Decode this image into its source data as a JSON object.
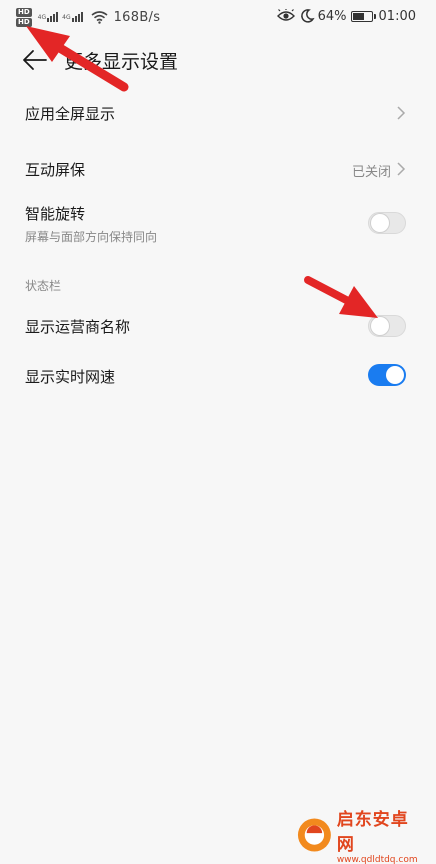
{
  "status_bar": {
    "hd_labels": [
      "HD",
      "HD"
    ],
    "sim1_tag": "4G",
    "sim2_tag": "4G",
    "net_speed": "168B/s",
    "battery_percent": "64%",
    "battery_level": 0.64,
    "time": "01:00"
  },
  "header": {
    "title": "更多显示设置"
  },
  "settings": {
    "fullscreen_apps": {
      "label": "应用全屏显示"
    },
    "interactive_screensaver": {
      "label": "互动屏保",
      "value": "已关闭"
    },
    "smart_rotate": {
      "label": "智能旋转",
      "sublabel": "屏幕与面部方向保持同向",
      "enabled": false
    },
    "status_section": "状态栏",
    "show_carrier": {
      "label": "显示运营商名称",
      "enabled": false
    },
    "show_net_speed": {
      "label": "显示实时网速",
      "enabled": true
    }
  },
  "colors": {
    "accent": "#1a7cf0",
    "annotation": "#e32626",
    "watermark": "#e1461e"
  },
  "watermark": {
    "name": "启东安卓网",
    "url": "www.qdldtdq.com"
  }
}
